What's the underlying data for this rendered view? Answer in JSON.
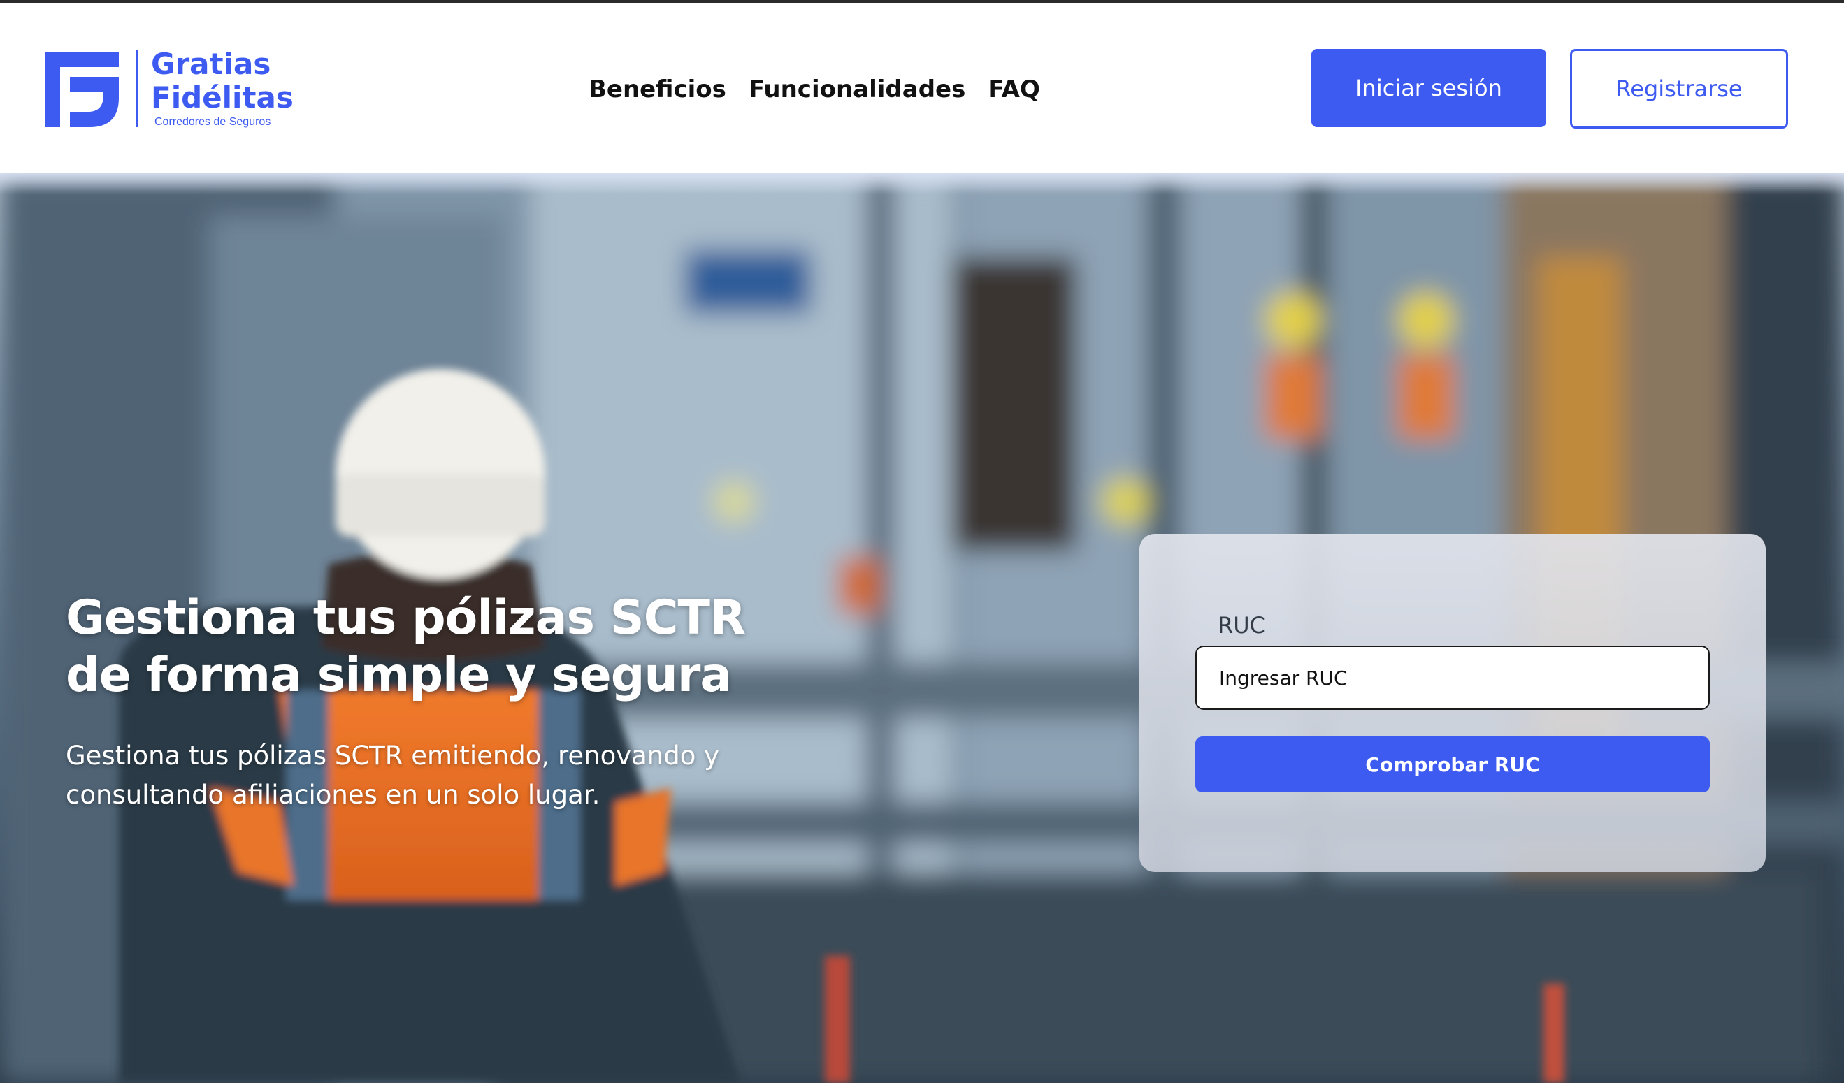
{
  "brand": {
    "name_line1": "Gratias",
    "name_line2": "Fidélitas",
    "tagline": "Corredores de Seguros",
    "color": "#3d5af1"
  },
  "nav": {
    "links": [
      {
        "label": "Beneficios"
      },
      {
        "label": "Funcionalidades"
      },
      {
        "label": "FAQ"
      }
    ]
  },
  "auth": {
    "login_label": "Iniciar sesión",
    "register_label": "Registrarse"
  },
  "hero": {
    "title_line1": "Gestiona tus pólizas SCTR",
    "title_line2": "de forma simple y segura",
    "subtitle_line1": "Gestiona tus pólizas SCTR emitiendo, renovando y",
    "subtitle_line2": "consultando afiliaciones en un solo lugar."
  },
  "ruc_form": {
    "label": "RUC",
    "placeholder": "Ingresar RUC",
    "button_label": "Comprobar RUC"
  }
}
